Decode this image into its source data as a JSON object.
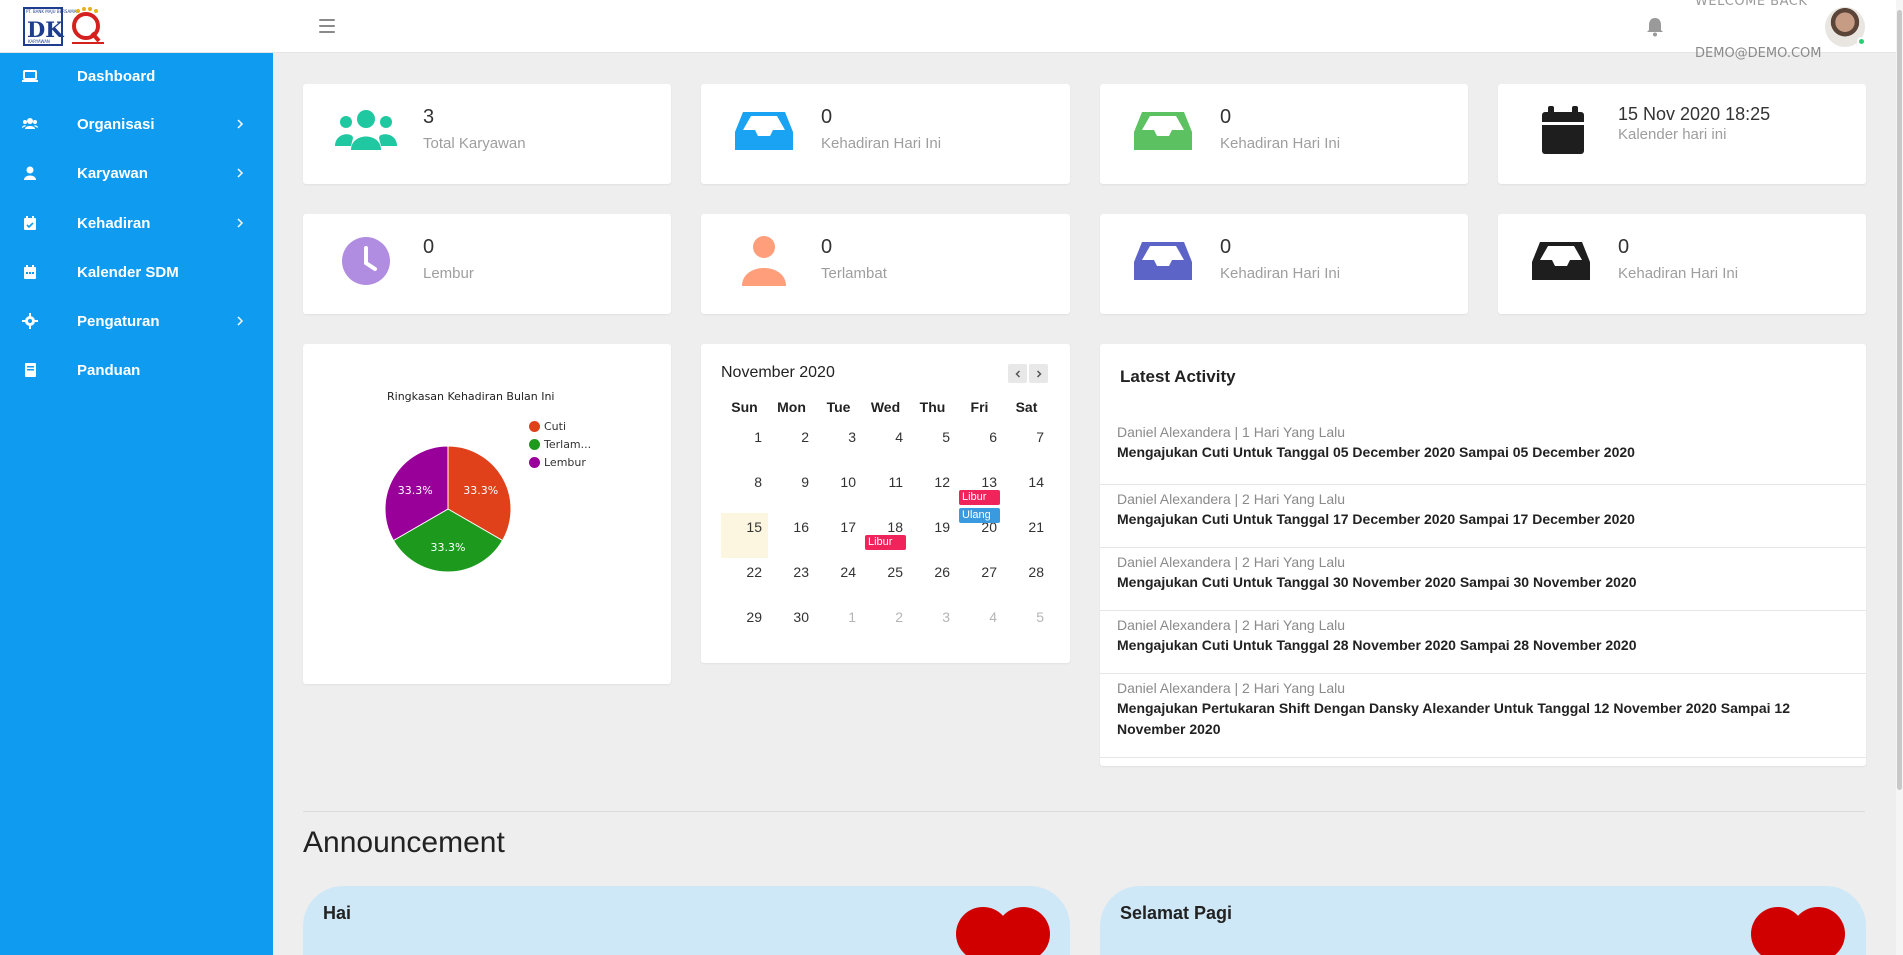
{
  "header": {
    "logo_top_text": "PT. BANK MAJU BERSAMA",
    "logo_letters": "DK",
    "logo_bottom_text": "KARYAWAN",
    "welcome": "WELCOME BACK",
    "email": "DEMO@DEMO.COM"
  },
  "sidebar": {
    "items": [
      {
        "label": "Dashboard",
        "icon": "laptop-icon",
        "has_children": false
      },
      {
        "label": "Organisasi",
        "icon": "users-icon",
        "has_children": true
      },
      {
        "label": "Karyawan",
        "icon": "user-icon",
        "has_children": true
      },
      {
        "label": "Kehadiran",
        "icon": "calendar-check-icon",
        "has_children": true
      },
      {
        "label": "Kalender SDM",
        "icon": "calendar-icon",
        "has_children": false
      },
      {
        "label": "Pengaturan",
        "icon": "gear-icon",
        "has_children": true
      },
      {
        "label": "Panduan",
        "icon": "book-icon",
        "has_children": false
      }
    ]
  },
  "stats": [
    {
      "value": "3",
      "label": "Total Karyawan",
      "icon": "users-icon",
      "color": "#1fc8a0"
    },
    {
      "value": "0",
      "label": "Kehadiran Hari Ini",
      "icon": "inbox-icon",
      "color": "#19a3f2"
    },
    {
      "value": "0",
      "label": "Kehadiran Hari Ini",
      "icon": "inbox-icon",
      "color": "#5cc160"
    },
    {
      "value": "15 Nov 2020 18:25",
      "label": "Kalender hari ini",
      "icon": "calendar-icon",
      "color": "#1e1e1e"
    },
    {
      "value": "0",
      "label": "Lembur",
      "icon": "clock-icon",
      "color": "#b08de0"
    },
    {
      "value": "0",
      "label": "Terlambat",
      "icon": "user-icon",
      "color": "#ff9e7a"
    },
    {
      "value": "0",
      "label": "Kehadiran Hari Ini",
      "icon": "inbox-icon",
      "color": "#5d64c8"
    },
    {
      "value": "0",
      "label": "Kehadiran Hari Ini",
      "icon": "inbox-icon",
      "color": "#1e1e1e"
    }
  ],
  "chart_data": {
    "type": "pie",
    "title": "Ringkasan Kehadiran Bulan Ini",
    "legend_position": "top-right",
    "slices": [
      {
        "name": "Cuti",
        "legend_label": "Cuti",
        "value": 33.3,
        "label": "33.3%",
        "color": "#e0401a"
      },
      {
        "name": "Terlambat",
        "legend_label": "Terlam...",
        "value": 33.3,
        "label": "33.3%",
        "color": "#1d9a1d"
      },
      {
        "name": "Lembur",
        "legend_label": "Lembur",
        "value": 33.3,
        "label": "33.3%",
        "color": "#990099"
      }
    ]
  },
  "calendar": {
    "title": "November 2020",
    "prev_icon": "chevron-left-icon",
    "next_icon": "chevron-right-icon",
    "days_of_week": [
      "Sun",
      "Mon",
      "Tue",
      "Wed",
      "Thu",
      "Fri",
      "Sat"
    ],
    "weeks": [
      [
        {
          "d": "1"
        },
        {
          "d": "2"
        },
        {
          "d": "3"
        },
        {
          "d": "4"
        },
        {
          "d": "5"
        },
        {
          "d": "6"
        },
        {
          "d": "7"
        }
      ],
      [
        {
          "d": "8"
        },
        {
          "d": "9"
        },
        {
          "d": "10"
        },
        {
          "d": "11"
        },
        {
          "d": "12"
        },
        {
          "d": "13"
        },
        {
          "d": "14"
        }
      ],
      [
        {
          "d": "15",
          "today": true
        },
        {
          "d": "16"
        },
        {
          "d": "17"
        },
        {
          "d": "18"
        },
        {
          "d": "19"
        },
        {
          "d": "20"
        },
        {
          "d": "21"
        }
      ],
      [
        {
          "d": "22"
        },
        {
          "d": "23"
        },
        {
          "d": "24"
        },
        {
          "d": "25"
        },
        {
          "d": "26"
        },
        {
          "d": "27"
        },
        {
          "d": "28"
        }
      ],
      [
        {
          "d": "29"
        },
        {
          "d": "30"
        },
        {
          "d": "1",
          "muted": true
        },
        {
          "d": "2",
          "muted": true
        },
        {
          "d": "3",
          "muted": true
        },
        {
          "d": "4",
          "muted": true
        },
        {
          "d": "5",
          "muted": true
        }
      ]
    ],
    "events": [
      {
        "label": "Libur",
        "week": 1,
        "day": 5,
        "slot": 0,
        "color": "#f0245a"
      },
      {
        "label": "Ulang",
        "week": 1,
        "day": 5,
        "slot": 1,
        "color": "#3a9ae0"
      },
      {
        "label": "Libur",
        "week": 2,
        "day": 3,
        "slot": 0,
        "color": "#f0245a"
      }
    ]
  },
  "activity": {
    "title": "Latest Activity",
    "items": [
      {
        "meta": "Daniel Alexandera | 1 Hari Yang Lalu",
        "text": "Mengajukan Cuti Untuk Tanggal 05 December 2020 Sampai 05 December 2020"
      },
      {
        "meta": "Daniel Alexandera | 2 Hari Yang Lalu",
        "text": "Mengajukan Cuti Untuk Tanggal 17 December 2020 Sampai 17 December 2020"
      },
      {
        "meta": "Daniel Alexandera | 2 Hari Yang Lalu",
        "text": "Mengajukan Cuti Untuk Tanggal 30 November 2020 Sampai 30 November 2020"
      },
      {
        "meta": "Daniel Alexandera | 2 Hari Yang Lalu",
        "text": "Mengajukan Cuti Untuk Tanggal 28 November 2020 Sampai 28 November 2020"
      },
      {
        "meta": "Daniel Alexandera | 2 Hari Yang Lalu",
        "text": "Mengajukan Pertukaran Shift Dengan Dansky Alexander Untuk Tanggal 12 November 2020 Sampai 12 November 2020"
      }
    ]
  },
  "announcement": {
    "heading": "Announcement",
    "cards": [
      {
        "title": "Hai",
        "icon": "heart-icon"
      },
      {
        "title": "Selamat Pagi",
        "icon": "heart-icon"
      }
    ]
  }
}
